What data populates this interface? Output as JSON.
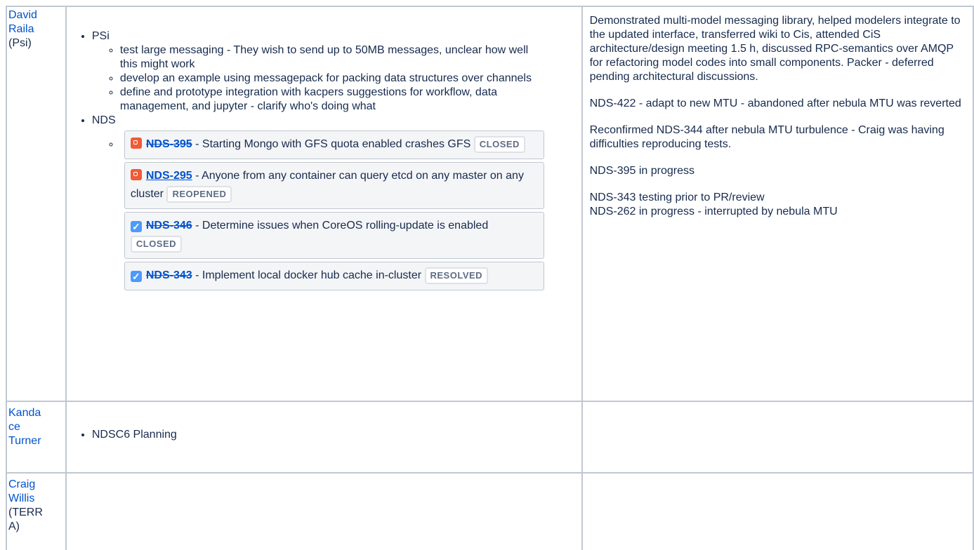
{
  "rows": [
    {
      "member": {
        "name": "David Raila",
        "name_line1": "David",
        "name_line2": "Raila",
        "suffix": "(Psi)"
      },
      "tasks": [
        {
          "label": "PSi",
          "subitems": [
            "test large messaging - They wish to send up to 50MB messages, unclear how well this might work",
            "develop an example using messagepack for packing data structures over channels",
            "define and prototype integration with kacpers suggestions for workflow, data management, and jupyter - clarify who's doing what"
          ]
        },
        {
          "label": "NDS",
          "issues": [
            {
              "type_icon": "bug-icon",
              "key": "NDS-395",
              "summary": "Starting Mongo with GFS quota enabled crashes GFS",
              "status": "CLOSED",
              "strikethrough": true
            },
            {
              "type_icon": "bug-icon",
              "key": "NDS-295",
              "summary": "Anyone from any container can query etcd on any master on any cluster",
              "status": "REOPENED",
              "strikethrough": false
            },
            {
              "type_icon": "checkbox-icon",
              "key": "NDS-346",
              "summary": "Determine issues when CoreOS rolling-update is enabled",
              "status": "CLOSED",
              "strikethrough": true
            },
            {
              "type_icon": "checkbox-icon",
              "key": "NDS-343",
              "summary": "Implement local docker hub cache in-cluster",
              "status": "RESOLVED",
              "strikethrough": true
            }
          ]
        }
      ],
      "notes": [
        "Demonstrated multi-model messaging library,   helped modelers integrate to the updated interface, transferred wiki to Cis,  attended CiS architecture/design meeting 1.5 h,  discussed RPC-semantics over AMQP for refactoring model codes into small components.  Packer - deferred pending architectural discussions.",
        "NDS-422 - adapt to new MTU - abandoned after nebula MTU was reverted",
        "Reconfirmed NDS-344 after nebula MTU  turbulence - Craig was having difficulties reproducing tests.",
        "NDS-395 in progress",
        "NDS-343 testing prior to PR/review",
        "NDS-262 in progress - interrupted by nebula MTU"
      ]
    },
    {
      "member": {
        "name": "Kandace Turner",
        "name_line1": "Kanda",
        "name_line2": "ce",
        "name_line3": "Turner"
      },
      "tasks": [
        {
          "label": "NDSC6 Planning"
        }
      ],
      "notes": []
    },
    {
      "member": {
        "name": "Craig Willis",
        "name_line1": "Craig",
        "name_line2": "Willis",
        "suffix_line1": "(TERR",
        "suffix_line2": "A)"
      },
      "tasks": [],
      "notes": []
    }
  ],
  "colors": {
    "link": "#0052cc",
    "border": "#c1c7d0",
    "bug": "#ef5b36",
    "task": "#4c9aff",
    "card_bg": "#f4f5f7"
  }
}
